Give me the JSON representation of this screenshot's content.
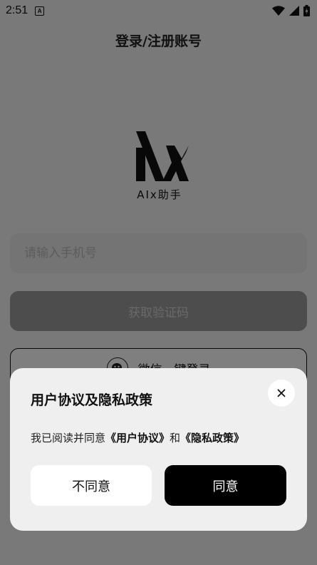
{
  "status_bar": {
    "time": "2:51",
    "notification_badge": "A",
    "icons": [
      "wifi-icon",
      "cell-signal-icon",
      "battery-charging-icon"
    ]
  },
  "header": {
    "title": "登录/注册账号"
  },
  "logo": {
    "text": "AIx助手"
  },
  "phone_input": {
    "placeholder": "请输入手机号",
    "value": ""
  },
  "get_code_button": {
    "label": "获取验证码"
  },
  "wechat_button": {
    "label": "微信一键登录",
    "icon": "wechat-icon"
  },
  "dialog": {
    "title": "用户协议及隐私政策",
    "message_prefix": "我已阅读并同意",
    "user_agreement_link": "《用户协议》",
    "conjunction": "和",
    "privacy_policy_link": "《隐私政策》",
    "disagree_label": "不同意",
    "agree_label": "同意",
    "close_icon": "close-icon"
  },
  "colors": {
    "primary": "#000000",
    "overlay": "rgba(0,0,0,0.5)",
    "dialog_bg": "#efefef"
  }
}
